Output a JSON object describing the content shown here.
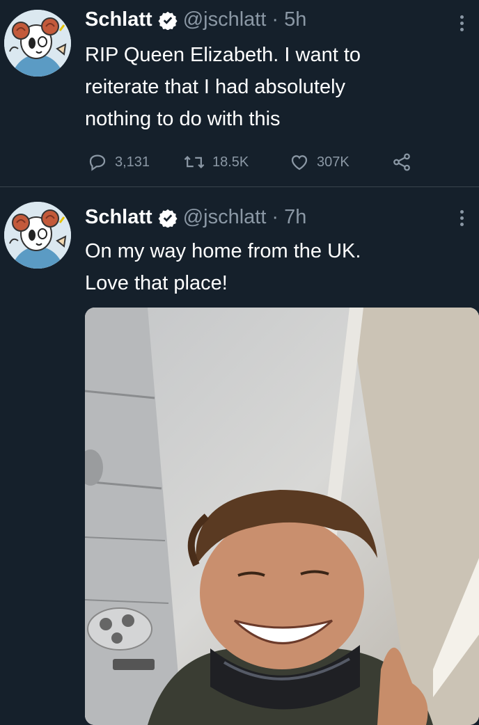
{
  "tweets": [
    {
      "author": {
        "name": "Schlatt",
        "handle": "@jschlatt",
        "verified": true,
        "avatar_icon": "cartoon-ram-avatar"
      },
      "separator": "·",
      "time": "5h",
      "text": "RIP Queen Elizabeth. I want to\nreiterate that I had absolutely\nnothing to do with this",
      "stats": {
        "replies": "3,131",
        "retweets": "18.5K",
        "likes": "307K"
      }
    },
    {
      "author": {
        "name": "Schlatt",
        "handle": "@jschlatt",
        "verified": true,
        "avatar_icon": "cartoon-ram-avatar"
      },
      "separator": "·",
      "time": "7h",
      "text": "On my way home from the UK.\nLove that place!",
      "media": {
        "type": "photo"
      }
    }
  ],
  "colors": {
    "background": "#15202b",
    "text": "#ffffff",
    "secondary_text": "#8b98a5",
    "divider": "#38444d",
    "verified_badge": "#ffffff"
  }
}
